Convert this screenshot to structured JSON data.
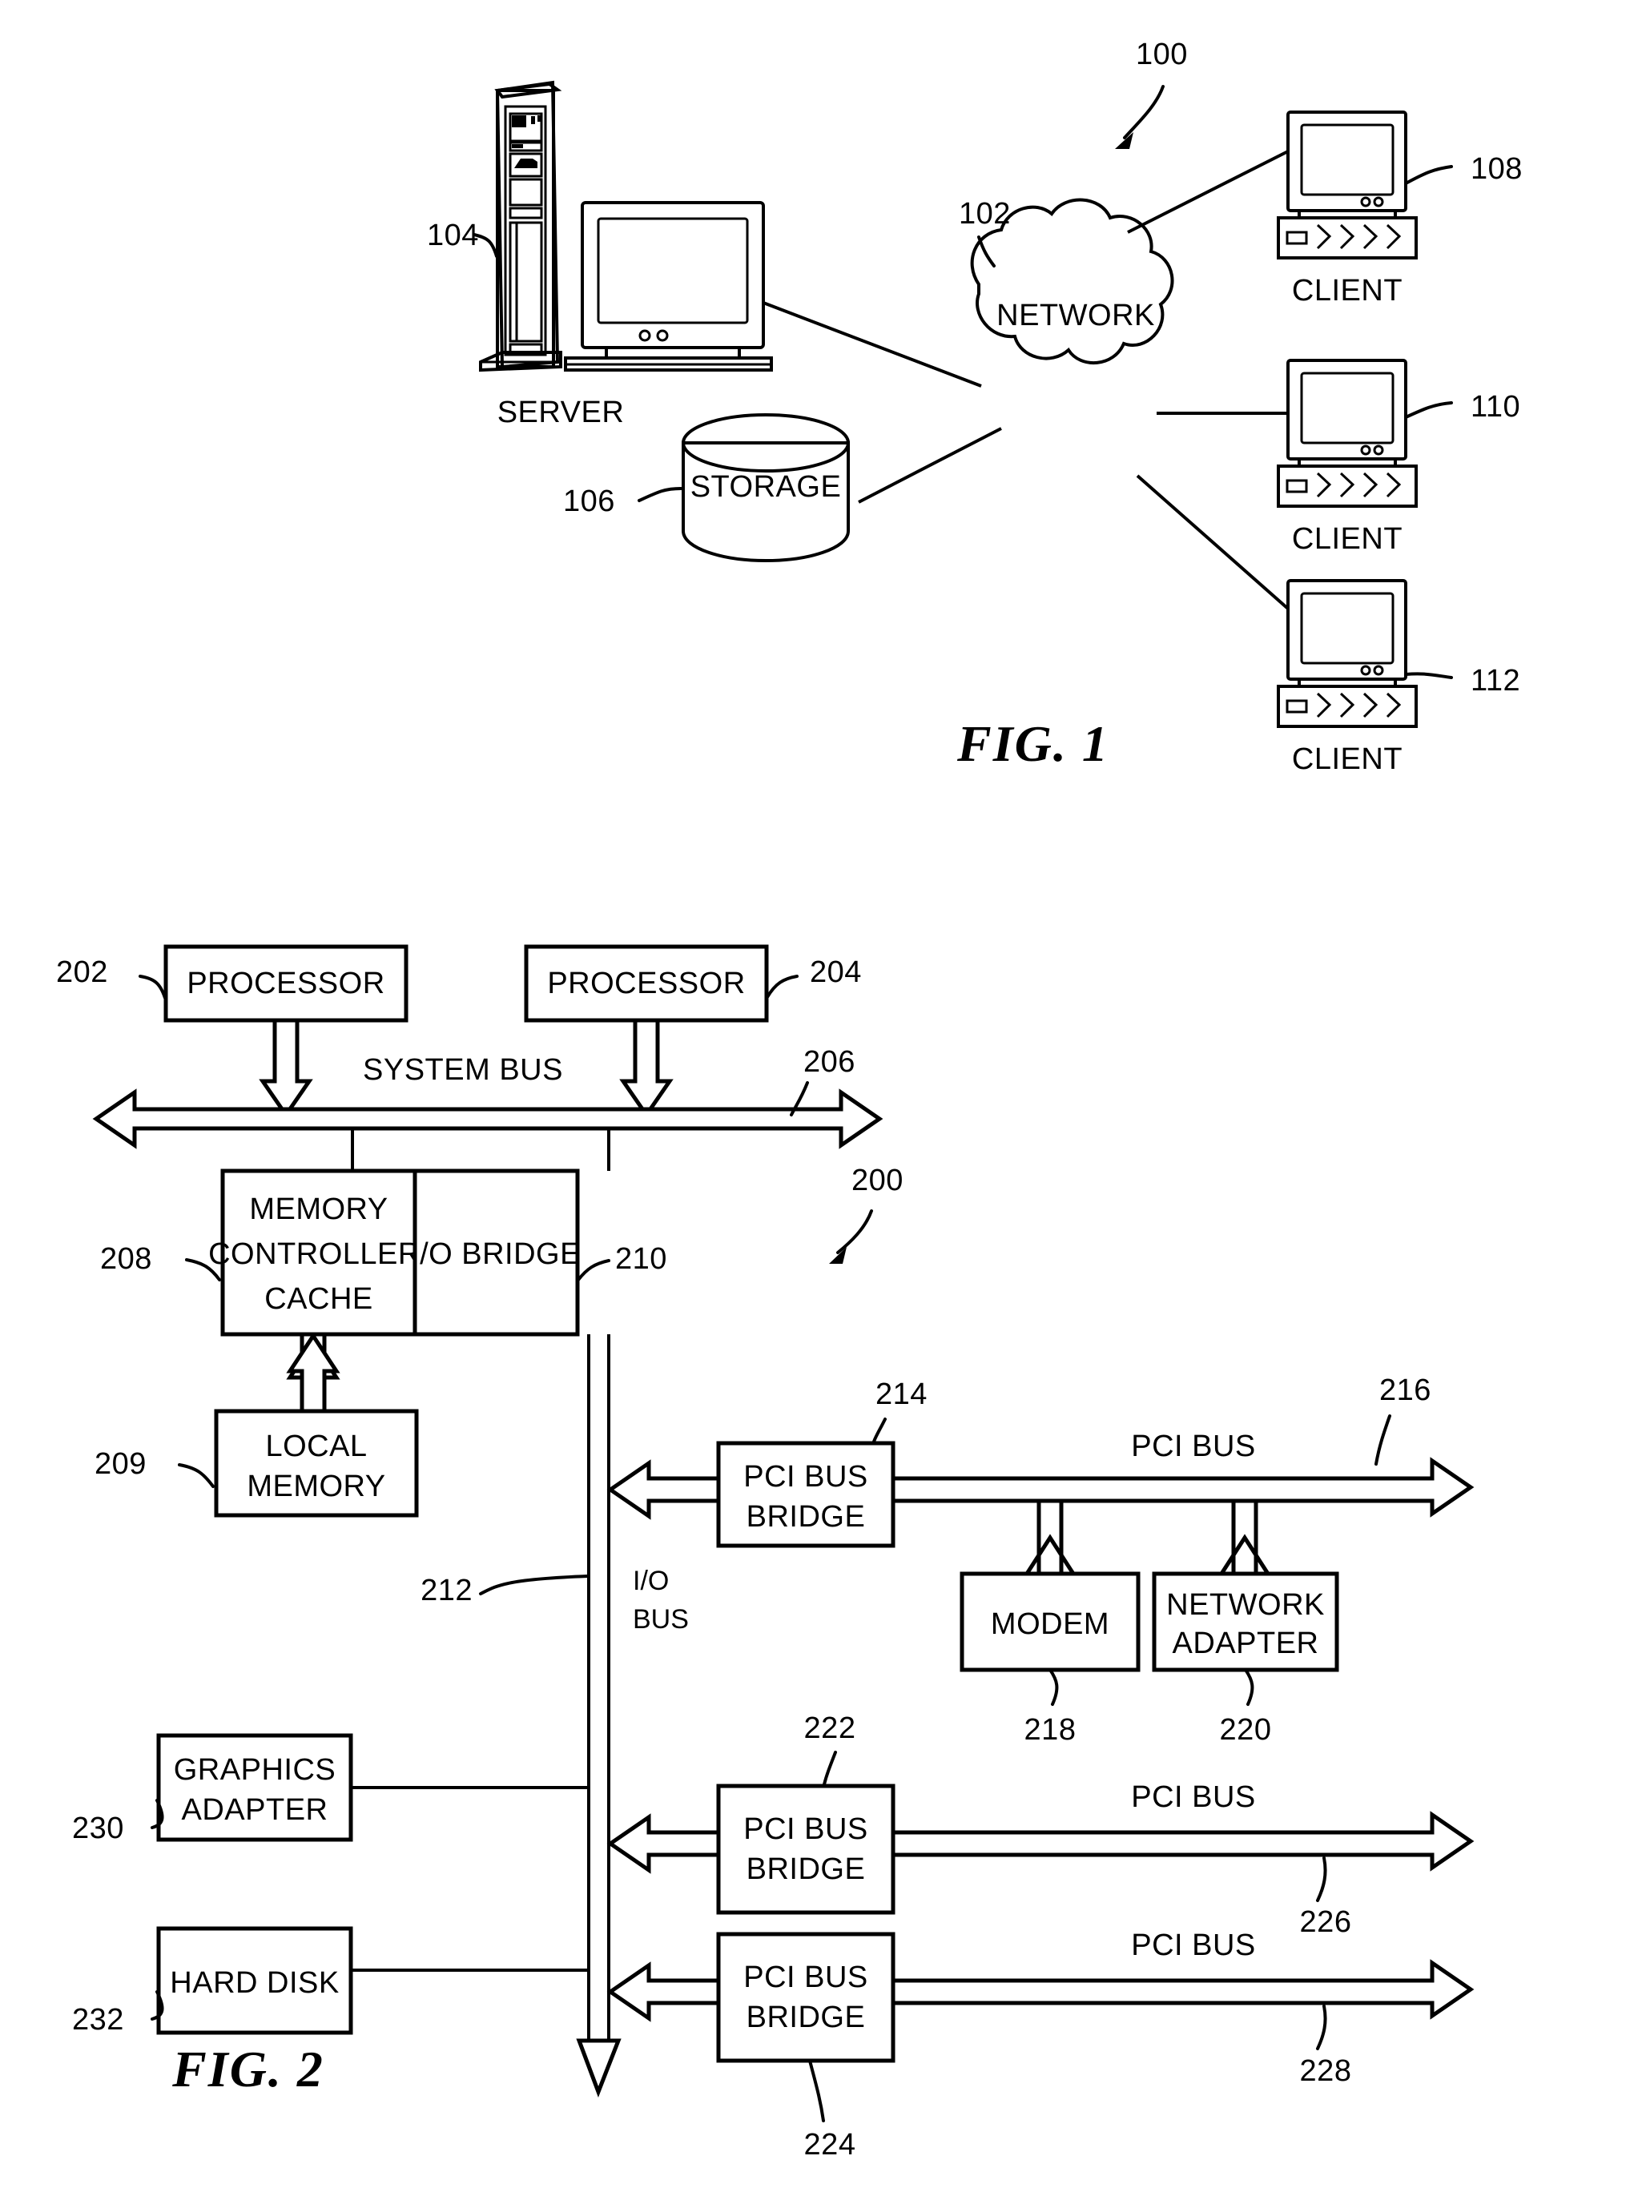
{
  "figure1": {
    "caption": "FIG. 1",
    "ref_system": "100",
    "nodes": {
      "server": {
        "label": "SERVER",
        "ref": "104"
      },
      "network": {
        "label": "NETWORK",
        "ref": "102"
      },
      "storage": {
        "label": "STORAGE",
        "ref": "106"
      },
      "client_top": {
        "label": "CLIENT",
        "ref": "108"
      },
      "client_mid": {
        "label": "CLIENT",
        "ref": "110"
      },
      "client_bottom": {
        "label": "CLIENT",
        "ref": "112"
      }
    }
  },
  "figure2": {
    "caption": "FIG. 2",
    "ref_system": "200",
    "blocks": {
      "processor1": {
        "label": "PROCESSOR",
        "ref": "202"
      },
      "processor2": {
        "label": "PROCESSOR",
        "ref": "204"
      },
      "system_bus": {
        "label": "SYSTEM BUS",
        "ref": "206"
      },
      "memory_controller": {
        "line1": "MEMORY",
        "line2": "CONTROLLER/",
        "line3": "CACHE",
        "ref": "208"
      },
      "io_bridge": {
        "label": "I/O BRIDGE",
        "ref": "210"
      },
      "local_memory": {
        "line1": "LOCAL",
        "line2": "MEMORY",
        "ref": "209"
      },
      "io_bus": {
        "line1": "I/O",
        "line2": "BUS",
        "ref": "212"
      },
      "pci_bus_bridge_1": {
        "line1": "PCI BUS",
        "line2": "BRIDGE",
        "ref": "214"
      },
      "pci_bus_1": {
        "label": "PCI BUS",
        "ref": "216"
      },
      "modem": {
        "label": "MODEM",
        "ref": "218"
      },
      "network_adapter": {
        "line1": "NETWORK",
        "line2": "ADAPTER",
        "ref": "220"
      },
      "pci_bus_bridge_2": {
        "line1": "PCI BUS",
        "line2": "BRIDGE",
        "ref": "222"
      },
      "pci_bus_2": {
        "label": "PCI BUS",
        "ref": "226"
      },
      "pci_bus_bridge_3": {
        "line1": "PCI BUS",
        "line2": "BRIDGE",
        "ref": "224"
      },
      "pci_bus_3": {
        "label": "PCI BUS",
        "ref": "228"
      },
      "graphics_adapter": {
        "line1": "GRAPHICS",
        "line2": "ADAPTER",
        "ref": "230"
      },
      "hard_disk": {
        "label": "HARD DISK",
        "ref": "232"
      }
    }
  },
  "colors": {
    "ink": "#000000",
    "paper": "#ffffff"
  }
}
